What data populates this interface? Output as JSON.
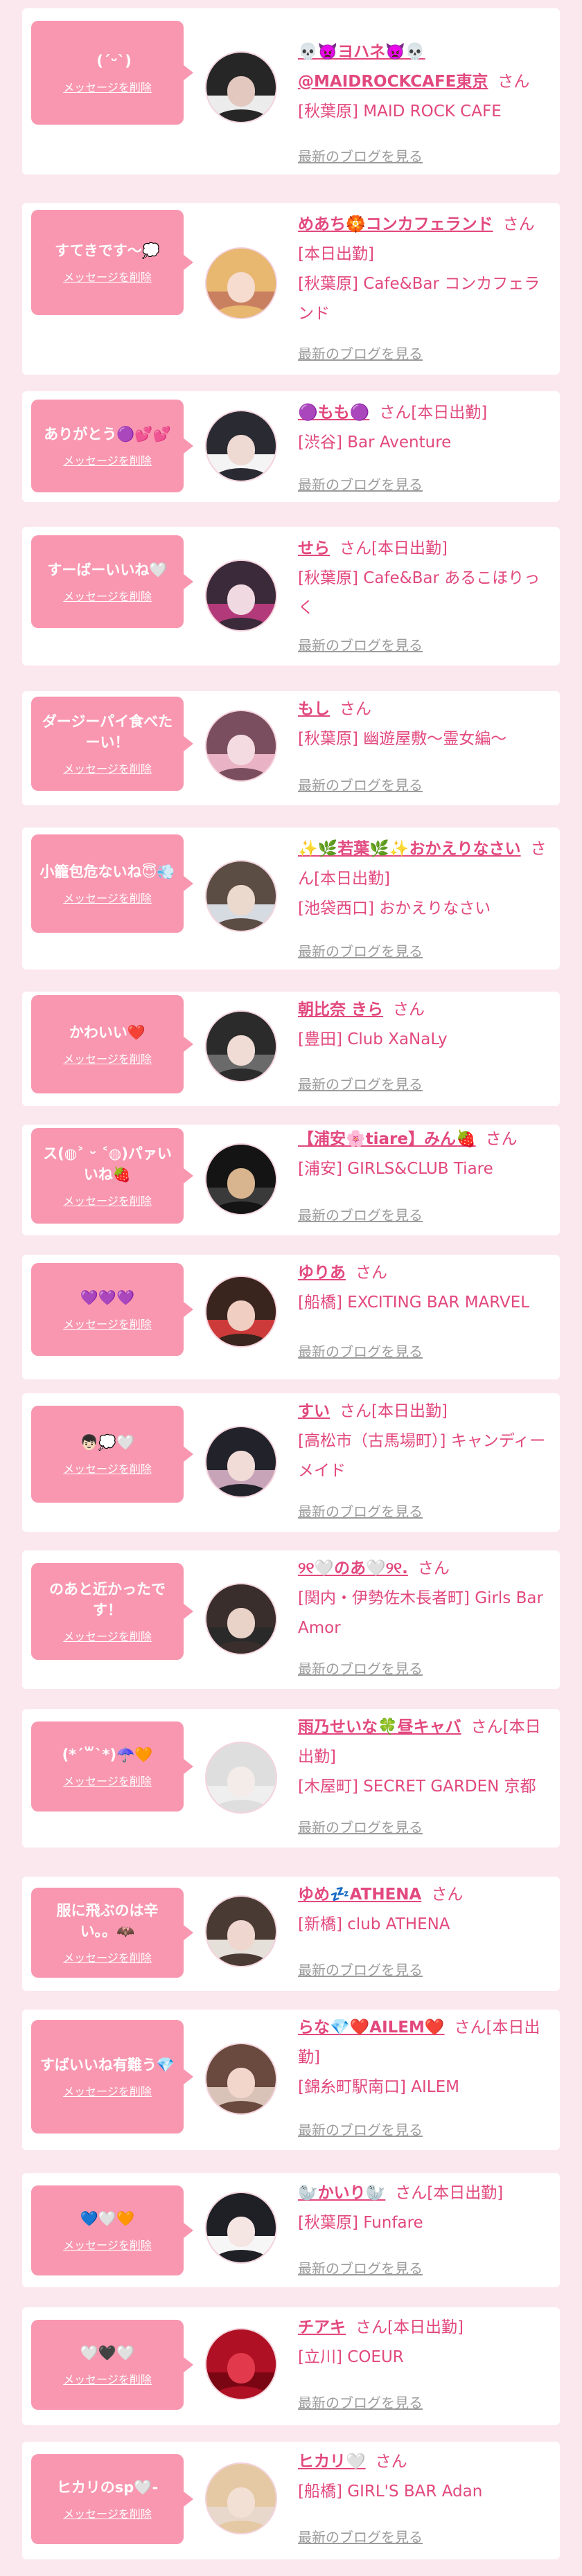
{
  "items": [
    {
      "message": "ﾠ(ˊᵕˋ)",
      "name": "💀👿ヨハネ👿💀@MAIDROCKCAFE東京",
      "tag": "",
      "shop": "[秋葉原] MAID ROCK CAFE",
      "avatar_colors": [
        "#262626",
        "#e3c8bf",
        "#ececec"
      ],
      "delete_label": "メッセージを削除",
      "blog_label": "最新のブログを見る"
    },
    {
      "message": "すてきです〜💭",
      "name": "めあち🏵️コンカフェランド",
      "tag": "[本日出勤]",
      "shop": "[秋葉原] Cafe&Bar コンカフェランド",
      "avatar_colors": [
        "#e8b770",
        "#f6dbcf",
        "#c98060"
      ],
      "delete_label": "メッセージを削除",
      "blog_label": "最新のブログを見る"
    },
    {
      "message": "ありがとう🟣💕💕",
      "name": "🟣もも🟣",
      "tag": "[本日出勤]",
      "shop": "[渋谷] Bar Aventure",
      "avatar_colors": [
        "#2a2a33",
        "#eed9d3",
        "#f4f4f4"
      ],
      "delete_label": "メッセージを削除",
      "blog_label": "最新のブログを見る"
    },
    {
      "message": "すーばーいいね🤍",
      "name": "せら",
      "tag": "[本日出勤]",
      "shop": "[秋葉原] Cafe&Bar あるこほりっく",
      "avatar_colors": [
        "#3a2a3a",
        "#f1d9e1",
        "#b33a7a"
      ],
      "delete_label": "メッセージを削除",
      "blog_label": "最新のブログを見る"
    },
    {
      "message": "ダージーパイ食べたーい！",
      "name": "もし",
      "tag": "",
      "shop": "[秋葉原] 幽遊屋敷〜霊女編〜",
      "avatar_colors": [
        "#7a4e5e",
        "#f4dbe2",
        "#e9b3c5"
      ],
      "delete_label": "メッセージを削除",
      "blog_label": "最新のブログを見る"
    },
    {
      "message": "小籠包危ないね😇💨",
      "name": "✨🌿若葉🌿✨おかえりなさい",
      "tag": "[本日出勤]",
      "shop": "[池袋西口] おかえりなさい",
      "avatar_colors": [
        "#5b4c44",
        "#ecd9cd",
        "#d6dbe2"
      ],
      "delete_label": "メッセージを削除",
      "blog_label": "最新のブログを見る"
    },
    {
      "message": "かわいい❤️",
      "name": "朝比奈 きら",
      "tag": "",
      "shop": "[豊田] Club XaNaLy",
      "avatar_colors": [
        "#2b2b2b",
        "#f0dcd5",
        "#6a6a6a"
      ],
      "delete_label": "メッセージを削除",
      "blog_label": "最新のブログを見る"
    },
    {
      "message": "ス(◍˃ ᵕ ˂◍)パァいいね🍓",
      "name": "【浦安🌸tiare】みん🍓",
      "tag": "",
      "shop": "[浦安] GIRLS&CLUB Tiare",
      "avatar_colors": [
        "#141414",
        "#d8b58f",
        "#3a3a3a"
      ],
      "delete_label": "メッセージを削除",
      "blog_label": "最新のブログを見る"
    },
    {
      "message": "💜💜💜",
      "name": "ゆりあ",
      "tag": "",
      "shop": "[船橋] EXCITING BAR MARVEL",
      "avatar_colors": [
        "#3a241e",
        "#f0cfc2",
        "#cc3a3a"
      ],
      "delete_label": "メッセージを削除",
      "blog_label": "最新のブログを見る"
    },
    {
      "message": "👦🏻💭🤍",
      "name": "すい",
      "tag": "[本日出勤]",
      "shop": "[高松市（古馬場町）] キャンディーメイド",
      "avatar_colors": [
        "#22222a",
        "#f2dcd8",
        "#c8a4b8"
      ],
      "delete_label": "メッセージを削除",
      "blog_label": "最新のブログを見る"
    },
    {
      "message": "のあと近かったです！",
      "name": "୨୧🤍のあ🤍୨୧.",
      "tag": "",
      "shop": "[関内・伊勢佐木長者町] Girls Bar Amor",
      "avatar_colors": [
        "#3a2e2c",
        "#e9d2c8",
        "#2a2a2a"
      ],
      "delete_label": "メッセージを削除",
      "blog_label": "最新のブログを見る"
    },
    {
      "message": "(*´꒳`*)☂️🧡",
      "name": "雨乃せいな🍀昼キャバ",
      "tag": "[本日出勤]",
      "shop": "[木屋町] SECRET GARDEN 京都",
      "avatar_colors": [
        "#dedede",
        "#f4ece9",
        "#efefef"
      ],
      "delete_label": "メッセージを削除",
      "blog_label": "最新のブログを見る"
    },
    {
      "message": "服に飛ぶのは辛い。。🦇",
      "name": "ゆめ💤ATHENA",
      "tag": "",
      "shop": "[新橋] club ATHENA",
      "avatar_colors": [
        "#4a3a34",
        "#efd7cf",
        "#e6e0da"
      ],
      "delete_label": "メッセージを削除",
      "blog_label": "最新のブログを見る"
    },
    {
      "message": "すばいいね有難う💎",
      "name": "らな💎❤️AILEM❤️",
      "tag": "[本日出勤]",
      "shop": "[錦糸町駅南口] AILEM",
      "avatar_colors": [
        "#6a4a3e",
        "#f2d6cc",
        "#d9c3b8"
      ],
      "delete_label": "メッセージを削除",
      "blog_label": "最新のブログを見る"
    },
    {
      "message": "💙🤍🧡",
      "name": "🦭かいり🦭",
      "tag": "[本日出勤]",
      "shop": "[秋葉原] Funfare",
      "avatar_colors": [
        "#1f1f26",
        "#f5e5e3",
        "#f6f6f6"
      ],
      "delete_label": "メッセージを削除",
      "blog_label": "最新のブログを見る"
    },
    {
      "message": "🤍🖤🤍",
      "name": "チアキ",
      "tag": "[本日出勤]",
      "shop": "[立川] COEUR",
      "avatar_colors": [
        "#b01024",
        "#e23a4c",
        "#7a0614"
      ],
      "delete_label": "メッセージを削除",
      "blog_label": "最新のブログを見る"
    },
    {
      "message": "ヒカリのsp🤍-",
      "name": "ヒカリ🤍",
      "tag": "",
      "shop": "[船橋] GIRL'S BAR Adan",
      "avatar_colors": [
        "#e5c9a4",
        "#f3e0d4",
        "#e8d8cc"
      ],
      "delete_label": "メッセージを削除",
      "blog_label": "最新のブログを見る"
    }
  ],
  "san_label": "さん",
  "colors": {
    "page_bg": "#fbe8ee",
    "bubble": "#f997b0",
    "accent_text": "#e2487e",
    "muted_text": "#9c9c9c"
  }
}
